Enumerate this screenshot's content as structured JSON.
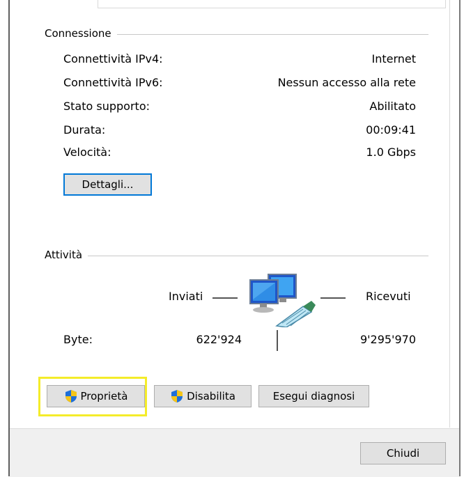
{
  "connessione": {
    "title": "Connessione",
    "rows": [
      {
        "label": "Connettività IPv4:",
        "value": "Internet"
      },
      {
        "label": "Connettività IPv6:",
        "value": "Nessun accesso alla rete"
      },
      {
        "label": "Stato supporto:",
        "value": "Abilitato"
      },
      {
        "label": "Durata:",
        "value": "00:09:41"
      },
      {
        "label": "Velocità:",
        "value": "1.0 Gbps"
      }
    ],
    "details_button": "Dettagli..."
  },
  "attivita": {
    "title": "Attività",
    "sent_label": "Inviati",
    "received_label": "Ricevuti",
    "bytes_label": "Byte:",
    "bytes_sent": "622'924",
    "bytes_received": "9'295'970"
  },
  "actions": {
    "properties": "Proprietà",
    "disable": "Disabilita",
    "diagnose": "Esegui diagnosi"
  },
  "footer": {
    "close": "Chiudi"
  },
  "colors": {
    "highlight": "#f4ec2a",
    "focus_border": "#0078d7",
    "shield_blue": "#1e6fd9",
    "shield_yellow": "#f5c518"
  }
}
